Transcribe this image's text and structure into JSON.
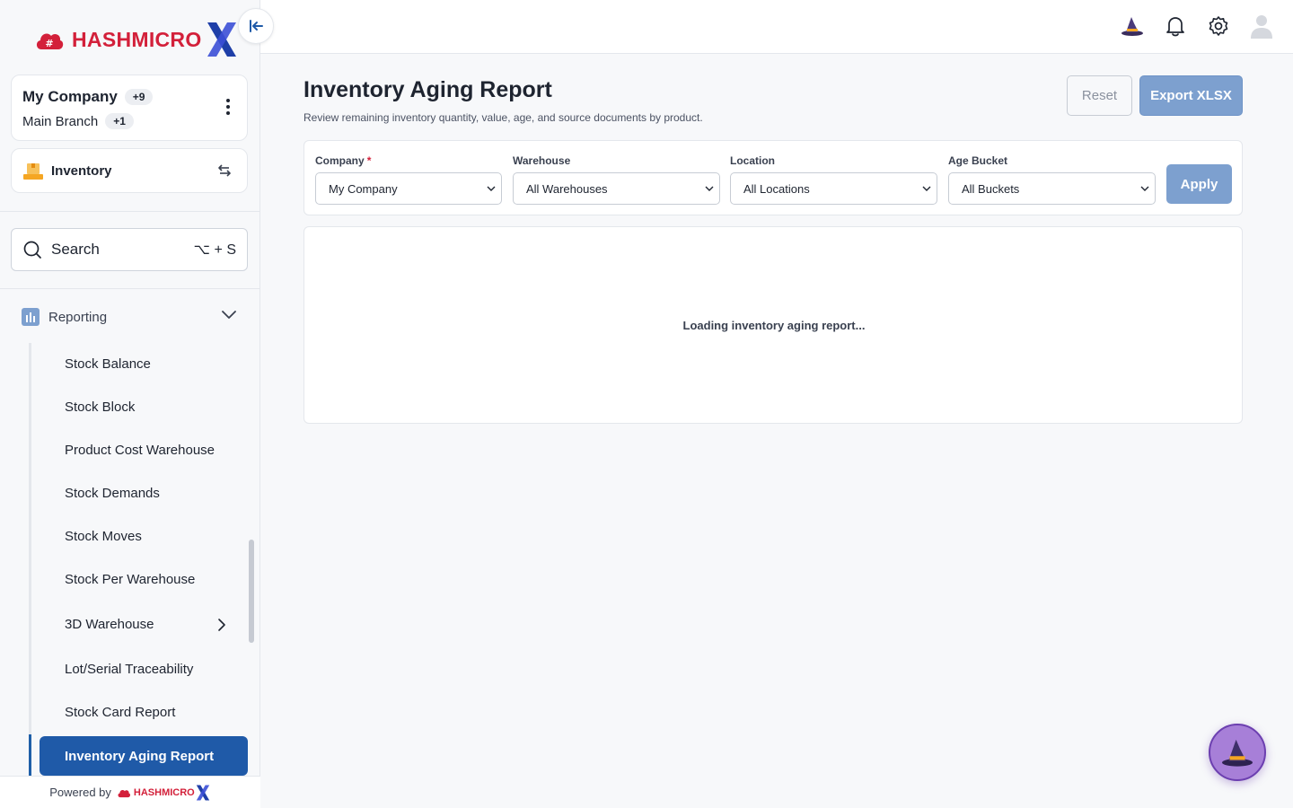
{
  "brand": {
    "name_bold": "HASHMICRO",
    "accent": "#d3203a",
    "primary": "#1f5aa8"
  },
  "company": {
    "name": "My Company",
    "company_count": "+9",
    "branch": "Main Branch",
    "branch_count": "+1"
  },
  "module": {
    "label": "Inventory"
  },
  "search": {
    "placeholder": "Search",
    "shortcut": "⌥ + S"
  },
  "nav": {
    "section_label": "Reporting",
    "items": [
      {
        "label": "Stock Balance"
      },
      {
        "label": "Stock Block"
      },
      {
        "label": "Product Cost Warehouse"
      },
      {
        "label": "Stock Demands"
      },
      {
        "label": "Stock Moves"
      },
      {
        "label": "Stock Per Warehouse"
      },
      {
        "label": "3D Warehouse"
      },
      {
        "label": "Lot/Serial Traceability"
      },
      {
        "label": "Stock Card Report"
      }
    ],
    "active_item": "Inventory Aging Report"
  },
  "footer": {
    "powered_by": "Powered by",
    "brand": "HASHMICRO"
  },
  "page": {
    "title": "Inventory Aging Report",
    "subtitle": "Review remaining inventory quantity, value, age, and source documents by product.",
    "reset_label": "Reset",
    "export_label": "Export XLSX"
  },
  "filters": {
    "company": {
      "label": "Company",
      "required": "*",
      "value": "My Company"
    },
    "warehouse": {
      "label": "Warehouse",
      "value": "All Warehouses"
    },
    "location": {
      "label": "Location",
      "value": "All Locations"
    },
    "age_bucket": {
      "label": "Age Bucket",
      "value": "All Buckets"
    },
    "apply_label": "Apply"
  },
  "report": {
    "loading_text": "Loading inventory aging report..."
  }
}
